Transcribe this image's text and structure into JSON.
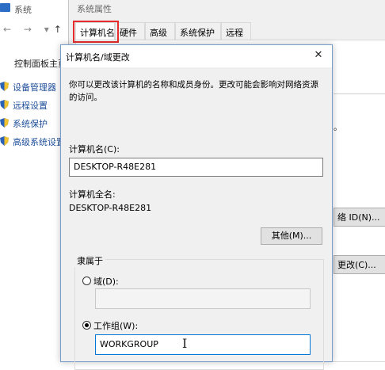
{
  "background_window": {
    "title": "系统",
    "nav_arrows": "← → ▾",
    "nav_up": "↑",
    "home_link": "控制面板主页",
    "sidebar_links": [
      {
        "label": "设备管理器",
        "icon": "shield-icon"
      },
      {
        "label": "远程设置",
        "icon": "shield-icon"
      },
      {
        "label": "系统保护",
        "icon": "shield-icon"
      },
      {
        "label": "高级系统设置",
        "icon": "shield-icon"
      }
    ],
    "right_text": "。",
    "network_id_button": "络 ID(N)...",
    "change_button": "更改(C)..."
  },
  "properties_window": {
    "title": "系统属性",
    "tabs": [
      "计算机名",
      "硬件",
      "高级",
      "系统保护",
      "远程"
    ],
    "active_tab": "计算机名",
    "highlight_color": "#e52b2b"
  },
  "dialog": {
    "title": "计算机名/域更改",
    "close_glyph": "✕",
    "description": "你可以更改该计算机的名称和成员身份。更改可能会影响对网络资源的访问。",
    "computer_name_label": "计算机名(C):",
    "computer_name_value": "DESKTOP-R48E281",
    "full_name_label": "计算机全名:",
    "full_name_value": "DESKTOP-R48E281",
    "more_button": "其他(M)...",
    "member_of_label": "隶属于",
    "domain_label": "域(D):",
    "domain_value": "",
    "workgroup_label": "工作组(W):",
    "workgroup_value": "WORKGROUP",
    "selected_option": "workgroup"
  }
}
